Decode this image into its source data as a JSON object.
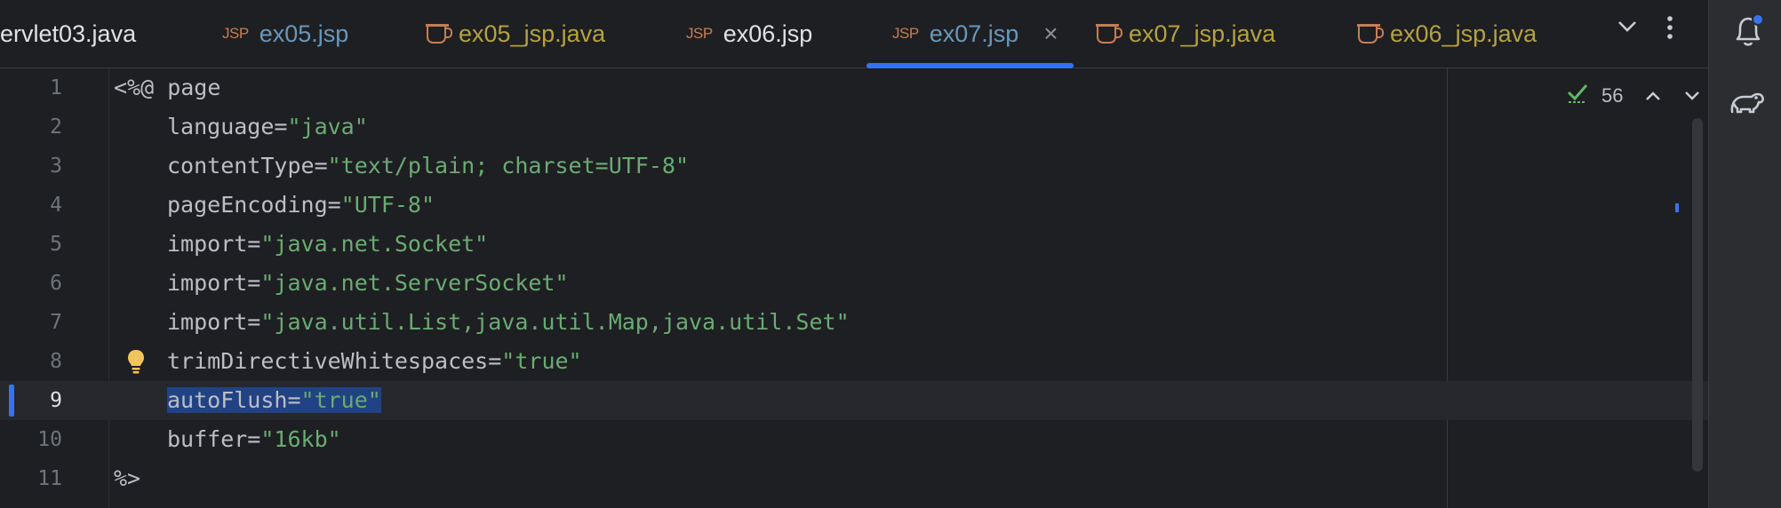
{
  "tabs": [
    {
      "label": "ervlet03.java",
      "type": "",
      "color": "#dfe1e5"
    },
    {
      "label": "ex05.jsp",
      "type": "JSP",
      "color": "#6897bb"
    },
    {
      "label": "ex05_jsp.java",
      "type": "java",
      "color": "#b5a23f"
    },
    {
      "label": "ex06.jsp",
      "type": "JSP",
      "color": "#dfe1e5"
    },
    {
      "label": "ex07.jsp",
      "type": "JSP",
      "color": "#6897bb",
      "active": true
    },
    {
      "label": "ex07_jsp.java",
      "type": "java",
      "color": "#b5a23f"
    },
    {
      "label": "ex06_jsp.java",
      "type": "java",
      "color": "#b5a23f"
    }
  ],
  "jsp_badge": "JSP",
  "close_glyph": "×",
  "inspection": {
    "count": "56"
  },
  "colors": {
    "accent": "#3574f0",
    "string": "#6aab73",
    "background": "#1e1f22",
    "selection": "#214283"
  },
  "lines": [
    {
      "n": "1",
      "text": "<%@ page"
    },
    {
      "n": "2",
      "key": "language=",
      "val": "\"java\""
    },
    {
      "n": "3",
      "key": "contentType=",
      "val": "\"text/plain; charset=UTF-8\""
    },
    {
      "n": "4",
      "key": "pageEncoding=",
      "val": "\"UTF-8\""
    },
    {
      "n": "5",
      "key": "import=",
      "val": "\"java.net.Socket\""
    },
    {
      "n": "6",
      "key": "import=",
      "val": "\"java.net.ServerSocket\""
    },
    {
      "n": "7",
      "key": "import=",
      "val": "\"java.util.List,java.util.Map,java.util.Set\""
    },
    {
      "n": "8",
      "key": "trimDirectiveWhitespaces=",
      "val": "\"true\""
    },
    {
      "n": "9",
      "key": "autoFlush=",
      "val": "\"true\"",
      "current": true
    },
    {
      "n": "10",
      "key": "buffer=",
      "val": "\"16kb\""
    },
    {
      "n": "11",
      "text": "%>"
    }
  ]
}
